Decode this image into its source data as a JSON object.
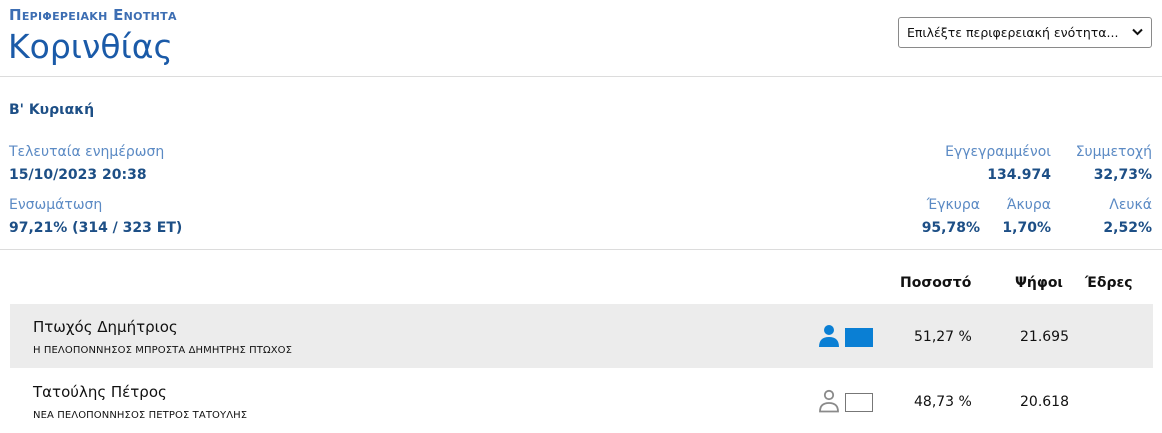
{
  "header": {
    "kicker": "Περιφερειακη Ενοτητα",
    "region": "Κορινθίας",
    "select_label": "Επιλέξτε περιφερειακή ενότητα...",
    "select_chevron": "⌄"
  },
  "round": "Β' Κυριακή",
  "stats": {
    "last_update_label": "Τελευταία ενημέρωση",
    "last_update_value": "15/10/2023 20:38",
    "integration_label": "Ενσωμάτωση",
    "integration_value": "97,21% (314 / 323 ΕΤ)",
    "registered_label": "Εγγεγραμμένοι",
    "registered_value": "134.974",
    "turnout_label": "Συμμετοχή",
    "turnout_value": "32,73%",
    "valid_label": "Έγκυρα",
    "valid_value": "95,78%",
    "invalid_label": "Άκυρα",
    "invalid_value": "1,70%",
    "blank_label": "Λευκά",
    "blank_value": "2,52%"
  },
  "table": {
    "headers": {
      "percent": "Ποσοστό",
      "votes": "Ψήφοι",
      "seats": "Έδρες"
    },
    "rows": [
      {
        "name": "Πτωχός Δημήτριος",
        "party": "Η ΠΕΛΟΠΟΝΝΗΣΟΣ ΜΠΡΟΣΤΑ ΔΗΜΗΤΡΗΣ ΠΤΩΧΟΣ",
        "percent": "51,27 %",
        "votes": "21.695",
        "seats": "",
        "color": "#0a7fd4",
        "icon": "person-filled-icon"
      },
      {
        "name": "Τατούλης Πέτρος",
        "party": "ΝΕΑ ΠΕΛΟΠΟΝΝΗΣΟΣ ΠΕΤΡΟΣ ΤΑΤΟΥΛΗΣ",
        "percent": "48,73 %",
        "votes": "20.618",
        "seats": "",
        "color": "#ffffff",
        "icon": "person-outline-icon"
      }
    ]
  },
  "colors": {
    "accent": "#1a5aa8",
    "label": "#5b8ac4",
    "value": "#1d4f86",
    "row_shade": "#ececec"
  }
}
